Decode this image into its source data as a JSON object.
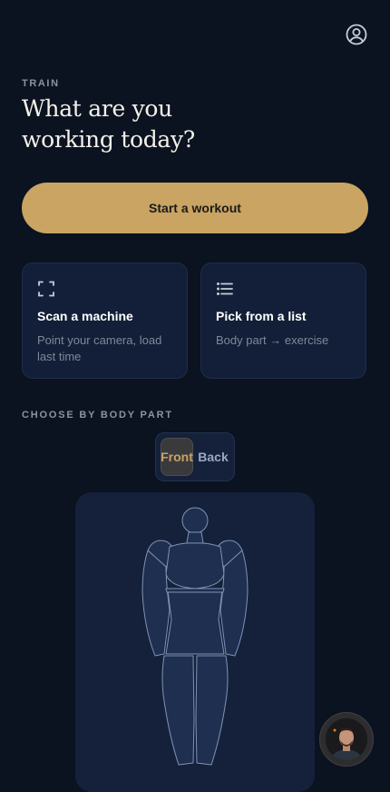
{
  "header": {
    "eyebrow": "TRAIN",
    "title": "What are you working today?",
    "profile_icon": "user-circle-icon"
  },
  "primary_action": {
    "label": "Start a workout",
    "color": "#c9a462"
  },
  "cards": [
    {
      "icon": "scan-frame-icon",
      "title": "Scan a machine",
      "subtitle": "Point your camera, load last time"
    },
    {
      "icon": "list-icon",
      "title": "Pick from a list",
      "subtitle": "Body part → exercise"
    }
  ],
  "body_section": {
    "label": "CHOOSE BY BODY PART",
    "toggle": {
      "options": [
        "Front",
        "Back"
      ],
      "selected": "Front"
    }
  },
  "coach": {
    "icon": "coach-avatar"
  },
  "colors": {
    "background": "#0b1220",
    "accent": "#c9a462",
    "card": "#131f38"
  }
}
